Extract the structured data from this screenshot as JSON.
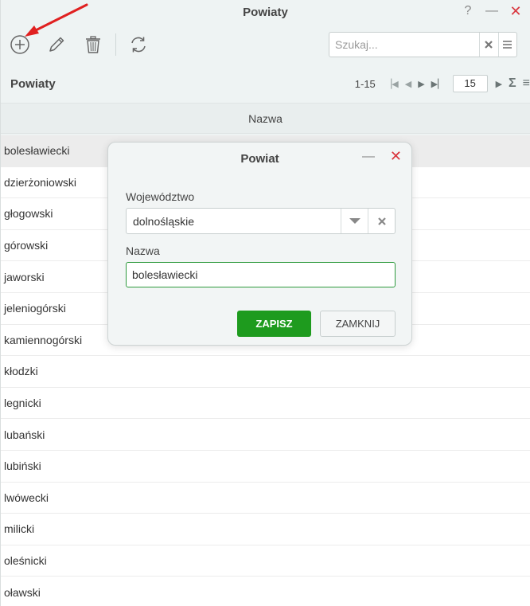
{
  "window": {
    "title": "Powiaty",
    "help_icon": "?",
    "minimize_icon": "—",
    "close_icon": "✕"
  },
  "toolbar": {
    "icons": [
      "add-icon",
      "edit-icon",
      "delete-icon",
      "refresh-icon"
    ]
  },
  "search": {
    "placeholder": "Szukaj..."
  },
  "grid": {
    "title": "Powiaty",
    "pager": {
      "range": "1-15",
      "page_size": "15"
    },
    "column_header": "Nazwa",
    "rows": [
      "bolesławiecki",
      "dzierżoniowski",
      "głogowski",
      "górowski",
      "jaworski",
      "jeleniogórski",
      "kamiennogórski",
      "kłodzki",
      "legnicki",
      "lubański",
      "lubiński",
      "lwówecki",
      "milicki",
      "oleśnicki",
      "oławski"
    ]
  },
  "dialog": {
    "title": "Powiat",
    "voivodeship_label": "Województwo",
    "voivodeship_value": "dolnośląskie",
    "name_label": "Nazwa",
    "name_value": "bolesławiecki",
    "save_label": "ZAPISZ",
    "close_label": "ZAMKNIJ"
  },
  "colors": {
    "accent_green": "#1e9b1e",
    "close_red": "#d9363e",
    "annotation_arrow": "#e02020"
  }
}
